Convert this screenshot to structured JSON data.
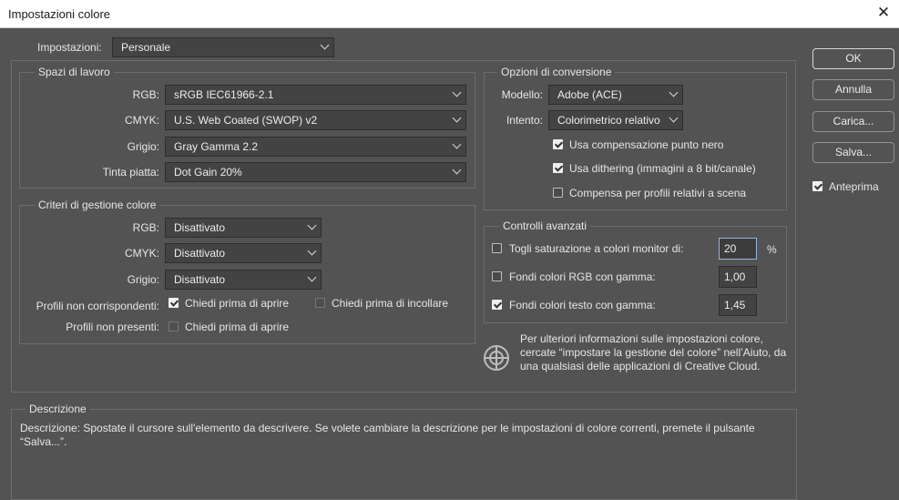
{
  "window": {
    "title": "Impostazioni colore"
  },
  "settings": {
    "label": "Impostazioni:",
    "value": "Personale"
  },
  "working_spaces": {
    "legend": "Spazi di lavoro",
    "rgb": {
      "label": "RGB:",
      "value": "sRGB IEC61966-2.1"
    },
    "cmyk": {
      "label": "CMYK:",
      "value": "U.S. Web Coated (SWOP) v2"
    },
    "gray": {
      "label": "Grigio:",
      "value": "Gray Gamma 2.2"
    },
    "spot": {
      "label": "Tinta piatta:",
      "value": "Dot Gain 20%"
    }
  },
  "policies": {
    "legend": "Criteri di gestione colore",
    "rgb": {
      "label": "RGB:",
      "value": "Disattivato"
    },
    "cmyk": {
      "label": "CMYK:",
      "value": "Disattivato"
    },
    "gray": {
      "label": "Grigio:",
      "value": "Disattivato"
    },
    "mismatch": {
      "label": "Profili non corrispondenti:",
      "ask_open": "Chiedi prima di aprire",
      "ask_paste": "Chiedi prima di incollare"
    },
    "missing": {
      "label": "Profili non presenti:",
      "ask_open": "Chiedi prima di aprire"
    }
  },
  "conversion": {
    "legend": "Opzioni di conversione",
    "engine": {
      "label": "Modello:",
      "value": "Adobe (ACE)"
    },
    "intent": {
      "label": "Intento:",
      "value": "Colorimetrico relativo"
    },
    "bpc": "Usa compensazione punto nero",
    "dither": "Usa dithering (immagini a 8 bit/canale)",
    "scene": "Compensa per profili relativi a scena"
  },
  "advanced": {
    "legend": "Controlli avanzati",
    "desaturate": {
      "label": "Togli saturazione a colori monitor di:",
      "value": "20",
      "unit": "%"
    },
    "blend_rgb": {
      "label": "Fondi colori RGB con gamma:",
      "value": "1,00"
    },
    "blend_text": {
      "label": "Fondi colori testo con gamma:",
      "value": "1,45"
    }
  },
  "info_text": "Per ulteriori informazioni sulle impostazioni colore, cercate “impostare la gestione del colore” nell’Aiuto, da una qualsiasi delle applicazioni di Creative Cloud.",
  "description": {
    "legend": "Descrizione",
    "text": "Descrizione: Spostate il cursore sull'elemento da descrivere. Se volete cambiare la descrizione per le impostazioni di colore correnti, premete il pulsante “Salva...”."
  },
  "buttons": {
    "ok": "OK",
    "cancel": "Annulla",
    "load": "Carica...",
    "save": "Salva...",
    "preview": "Anteprima"
  }
}
